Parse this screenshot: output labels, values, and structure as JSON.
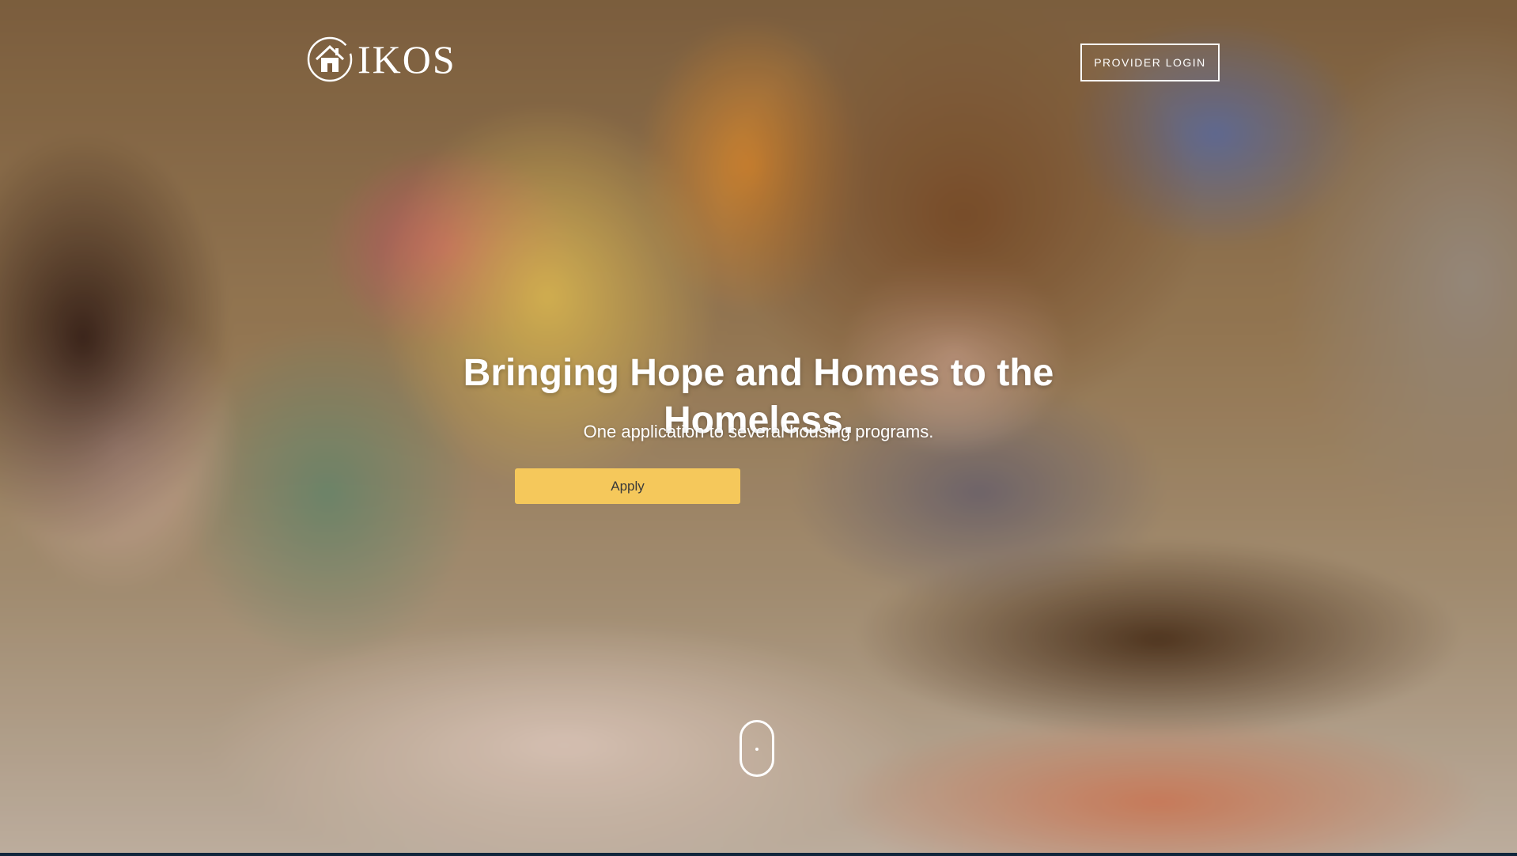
{
  "header": {
    "logo_text": "IKOS",
    "logo_icon": "house-circle-logo-icon",
    "provider_login_label": "PROVIDER LOGIN"
  },
  "hero": {
    "headline": "Bringing Hope and Homes to the Homeless.",
    "subheadline": "One application to several housing programs.",
    "apply_label": "Apply",
    "scroll_icon": "mouse-scroll-icon"
  },
  "colors": {
    "apply_button": "#f5c85b",
    "text": "#ffffff",
    "bottom_strip": "#10263c"
  }
}
